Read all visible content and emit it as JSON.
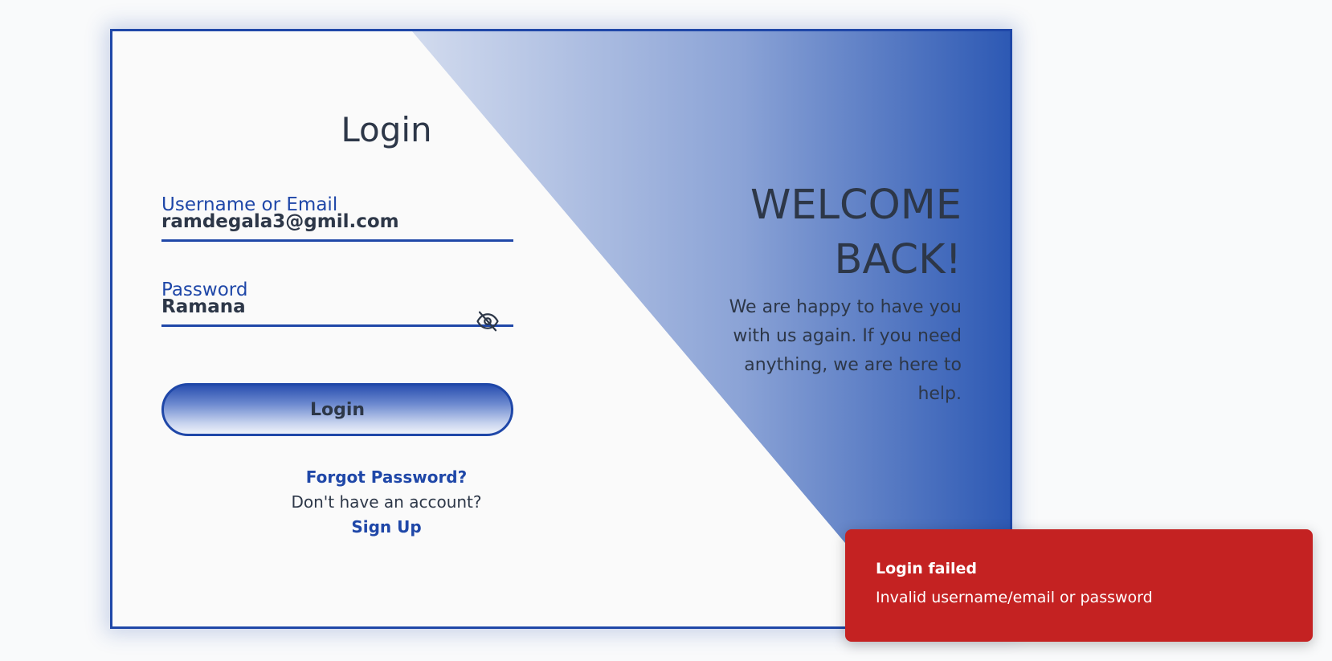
{
  "login_form": {
    "title": "Login",
    "username_label": "Username or Email",
    "username_value": "ramdegala3@gmil.com",
    "password_label": "Password",
    "password_value": "Ramana",
    "password_toggle_icon": "eye-off-icon",
    "submit_label": "Login",
    "forgot_password_link": "Forgot Password?",
    "no_account_text": "Don't have an account?",
    "signup_link": "Sign Up"
  },
  "welcome_panel": {
    "heading": "WELCOME BACK!",
    "message": "We are happy to have you with us again. If you need anything, we are here to help."
  },
  "toast": {
    "title": "Login failed",
    "description": "Invalid username/email or password"
  },
  "colors": {
    "accent": "#1f47a8",
    "text": "#2d3748",
    "error": "#c42222",
    "background": "#f9fafb"
  }
}
